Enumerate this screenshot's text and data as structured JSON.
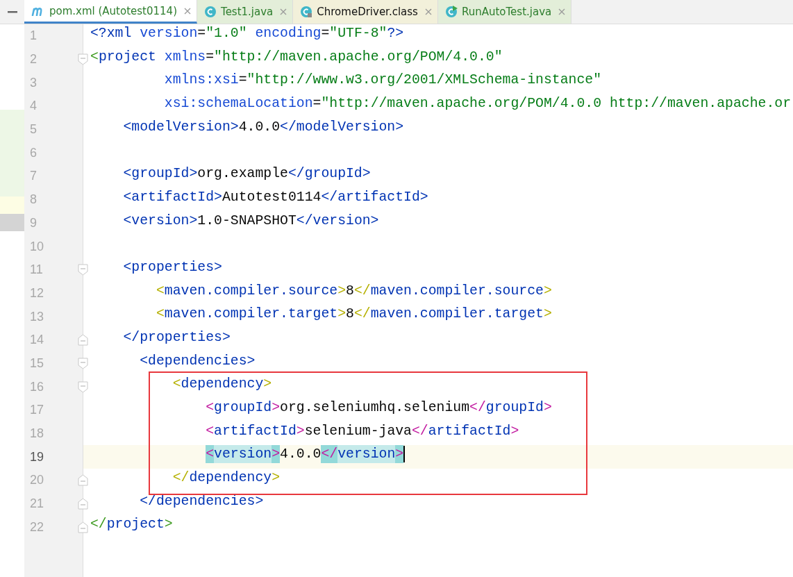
{
  "tabs": [
    {
      "label": "pom.xml (Autotest0114)",
      "kind": "maven",
      "selected": true,
      "added": true,
      "color": "#ffffff"
    },
    {
      "label": "Test1.java",
      "kind": "class",
      "selected": false,
      "added": true,
      "color": "#e3eed9"
    },
    {
      "label": "ChromeDriver.class",
      "kind": "library",
      "selected": false,
      "added": false,
      "color": "#f2f0da"
    },
    {
      "label": "RunAutoTest.java",
      "kind": "runnable",
      "selected": false,
      "added": true,
      "color": "#e3eed9"
    }
  ],
  "editor": {
    "lines": [
      {
        "number": "1",
        "current": false,
        "tokens": [
          {
            "kind": "tag",
            "text": "<?xml"
          },
          {
            "kind": "attr",
            "text": " version"
          },
          {
            "kind": "text",
            "text": "="
          },
          {
            "kind": "value",
            "text": "\"1.0\""
          },
          {
            "kind": "attr",
            "text": " encoding"
          },
          {
            "kind": "text",
            "text": "="
          },
          {
            "kind": "value",
            "text": "\"UTF-8\""
          },
          {
            "kind": "tag",
            "text": "?>"
          }
        ]
      },
      {
        "number": "2",
        "current": false,
        "fold_start": true,
        "tokens": [
          {
            "kind": "gbracket",
            "text": "<"
          },
          {
            "kind": "tag",
            "text": "project"
          },
          {
            "kind": "attr",
            "text": " xmlns"
          },
          {
            "kind": "text",
            "text": "="
          },
          {
            "kind": "value",
            "text": "\"http://maven.apache.org/POM/4.0.0\""
          }
        ]
      },
      {
        "number": "3",
        "current": false,
        "tokens": [
          {
            "kind": "attr",
            "text": "         xmlns:xsi"
          },
          {
            "kind": "text",
            "text": "="
          },
          {
            "kind": "value",
            "text": "\"http://www.w3.org/2001/XMLSchema-instance\""
          }
        ]
      },
      {
        "number": "4",
        "current": false,
        "tokens": [
          {
            "kind": "attr",
            "text": "         xsi:schemaLocation"
          },
          {
            "kind": "text",
            "text": "="
          },
          {
            "kind": "value",
            "text": "\"http://maven.apache.org/POM/4.0.0 http://maven.apache.or"
          }
        ]
      },
      {
        "number": "5",
        "current": false,
        "tokens": [
          {
            "kind": "tag",
            "text": "    <modelVersion>"
          },
          {
            "kind": "text",
            "text": "4.0.0"
          },
          {
            "kind": "tag",
            "text": "</modelVersion>"
          }
        ]
      },
      {
        "number": "6",
        "current": false
      },
      {
        "number": "7",
        "current": false,
        "tokens": [
          {
            "kind": "tag",
            "text": "    <groupId>"
          },
          {
            "kind": "text",
            "text": "org.example"
          },
          {
            "kind": "tag",
            "text": "</groupId>"
          }
        ]
      },
      {
        "number": "8",
        "current": false,
        "tokens": [
          {
            "kind": "tag",
            "text": "    <artifactId>"
          },
          {
            "kind": "text",
            "text": "Autotest0114"
          },
          {
            "kind": "tag",
            "text": "</artifactId>"
          }
        ]
      },
      {
        "number": "9",
        "current": false,
        "tokens": [
          {
            "kind": "tag",
            "text": "    <version>"
          },
          {
            "kind": "text",
            "text": "1.0-SNAPSHOT"
          },
          {
            "kind": "tag",
            "text": "</version>"
          }
        ]
      },
      {
        "number": "10",
        "current": false
      },
      {
        "number": "11",
        "current": false,
        "fold_start": true,
        "tokens": [
          {
            "kind": "tag",
            "text": "    <properties>"
          }
        ]
      },
      {
        "number": "12",
        "current": false,
        "tokens": [
          {
            "kind": "ybracket",
            "text": "        <"
          },
          {
            "kind": "tag",
            "text": "maven.compiler.source"
          },
          {
            "kind": "ybracket",
            "text": ">"
          },
          {
            "kind": "text",
            "text": "8"
          },
          {
            "kind": "ybracket",
            "text": "</"
          },
          {
            "kind": "tag",
            "text": "maven.compiler.source"
          },
          {
            "kind": "ybracket",
            "text": ">"
          }
        ]
      },
      {
        "number": "13",
        "current": false,
        "tokens": [
          {
            "kind": "ybracket",
            "text": "        <"
          },
          {
            "kind": "tag",
            "text": "maven.compiler.target"
          },
          {
            "kind": "ybracket",
            "text": ">"
          },
          {
            "kind": "text",
            "text": "8"
          },
          {
            "kind": "ybracket",
            "text": "</"
          },
          {
            "kind": "tag",
            "text": "maven.compiler.target"
          },
          {
            "kind": "ybracket",
            "text": ">"
          }
        ]
      },
      {
        "number": "14",
        "current": false,
        "fold_end": true,
        "tokens": [
          {
            "kind": "tag",
            "text": "    </properties>"
          }
        ]
      },
      {
        "number": "15",
        "current": false,
        "fold_start": true,
        "tokens": [
          {
            "kind": "tag",
            "text": "      <dependencies>"
          }
        ]
      },
      {
        "number": "16",
        "current": false,
        "boxed": true,
        "fold_start": true,
        "tokens": [
          {
            "kind": "ybracket",
            "text": "          <"
          },
          {
            "kind": "tag",
            "text": "dependency"
          },
          {
            "kind": "ybracket",
            "text": ">"
          }
        ]
      },
      {
        "number": "17",
        "current": false,
        "boxed": true,
        "tokens": [
          {
            "kind": "mbracket",
            "text": "              <"
          },
          {
            "kind": "tag",
            "text": "groupId"
          },
          {
            "kind": "mbracket",
            "text": ">"
          },
          {
            "kind": "text",
            "text": "org.seleniumhq.selenium"
          },
          {
            "kind": "mbracket",
            "text": "</"
          },
          {
            "kind": "tag",
            "text": "groupId"
          },
          {
            "kind": "mbracket",
            "text": ">"
          }
        ]
      },
      {
        "number": "18",
        "current": false,
        "boxed": true,
        "tokens": [
          {
            "kind": "mbracket",
            "text": "              <"
          },
          {
            "kind": "tag",
            "text": "artifactId"
          },
          {
            "kind": "mbracket",
            "text": ">"
          },
          {
            "kind": "text",
            "text": "selenium-java"
          },
          {
            "kind": "mbracket",
            "text": "</"
          },
          {
            "kind": "tag",
            "text": "artifactId"
          },
          {
            "kind": "mbracket",
            "text": ">"
          }
        ]
      },
      {
        "number": "19",
        "current": true,
        "boxed": true,
        "tokens": [
          {
            "kind": "mbracket",
            "text": "              <",
            "matched": true
          },
          {
            "kind": "tag",
            "text": "version",
            "matched": true
          },
          {
            "kind": "mbracket",
            "text": ">",
            "matched": true
          },
          {
            "kind": "text",
            "text": "4.0.0",
            "matched": false
          },
          {
            "kind": "mbracket",
            "text": "</",
            "matched": true
          },
          {
            "kind": "tag",
            "text": "version",
            "matched": true
          },
          {
            "kind": "mbracket",
            "text": ">",
            "matched": true
          }
        ]
      },
      {
        "number": "20",
        "current": false,
        "boxed": true,
        "fold_end": true,
        "tokens": [
          {
            "kind": "ybracket",
            "text": "          </"
          },
          {
            "kind": "tag",
            "text": "dependency"
          },
          {
            "kind": "ybracket",
            "text": ">"
          }
        ]
      },
      {
        "number": "21",
        "current": false,
        "fold_end": true,
        "tokens": [
          {
            "kind": "tag",
            "text": "      </dependencies>"
          }
        ]
      },
      {
        "number": "22",
        "current": false,
        "fold_end": true,
        "tokens": [
          {
            "kind": "gbracket",
            "text": "</"
          },
          {
            "kind": "tag",
            "text": "project"
          },
          {
            "kind": "gbracket",
            "text": ">"
          }
        ]
      }
    ]
  }
}
